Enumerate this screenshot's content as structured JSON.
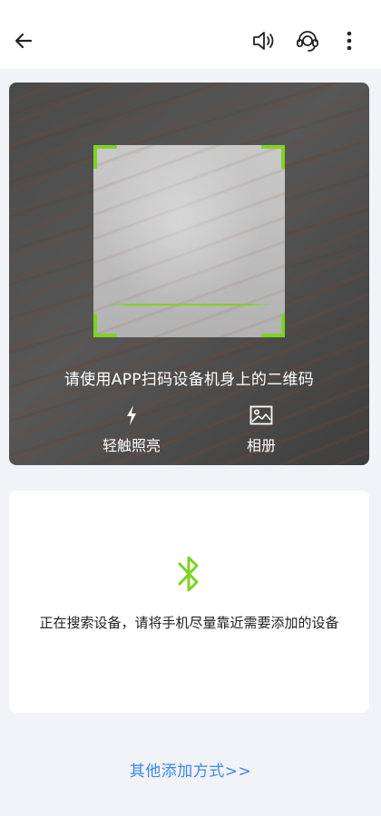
{
  "header": {
    "back_icon": "arrow-left-icon",
    "sound_icon": "speaker-icon",
    "support_icon": "headset-icon",
    "more_icon": "more-vertical-icon"
  },
  "scanner": {
    "hint": "请使用APP扫码设备机身上的二维码",
    "frame_color": "#7ed321",
    "tools": {
      "flash": {
        "label": "轻触照亮",
        "icon": "flash-icon"
      },
      "album": {
        "label": "相册",
        "icon": "image-icon"
      }
    }
  },
  "search": {
    "icon": "bluetooth-icon",
    "icon_color": "#7ed321",
    "text": "正在搜索设备，请将手机尽量靠近需要添加的设备"
  },
  "footer": {
    "other_methods": "其他添加方式>>",
    "link_color": "#3a86f0"
  }
}
